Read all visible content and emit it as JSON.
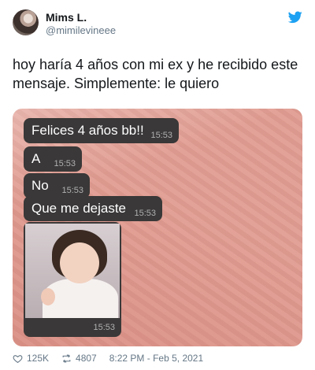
{
  "author": {
    "name": "Mims L.",
    "handle": "@mimilevineee"
  },
  "tweet": {
    "text": "hoy haría 4 años con mi ex y he recibido este mensaje. Simplemente: le quiero"
  },
  "chat": {
    "messages": [
      {
        "text": "Felices 4 años bb!!",
        "time": "15:53"
      },
      {
        "text": "A",
        "time": "15:53"
      },
      {
        "text": "No",
        "time": "15:53"
      },
      {
        "text": "Que me dejaste",
        "time": "15:53"
      }
    ],
    "photo_time": "15:53"
  },
  "footer": {
    "likes": "125K",
    "retweets": "4807",
    "timestamp": "8:22 PM - Feb 5, 2021"
  },
  "colors": {
    "twitter_blue": "#1da1f2",
    "chat_bubble": "#3a3838",
    "chat_background": "#e29d92"
  },
  "icons": {
    "header": "twitter-bird-icon",
    "likes": "heart-icon",
    "retweets": "retweet-icon"
  }
}
